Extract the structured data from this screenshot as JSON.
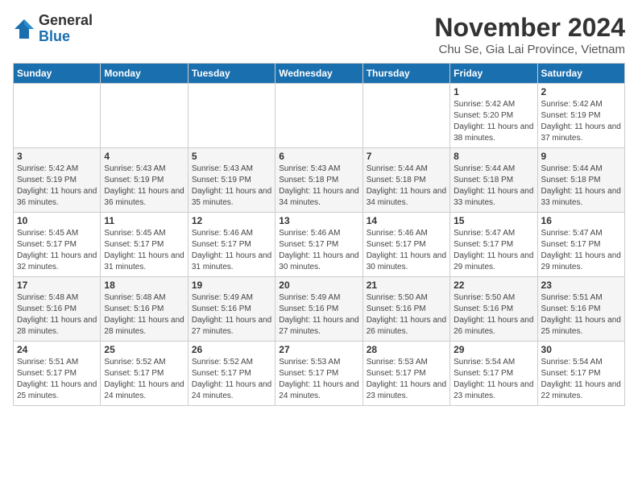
{
  "header": {
    "logo_general": "General",
    "logo_blue": "Blue",
    "month_title": "November 2024",
    "subtitle": "Chu Se, Gia Lai Province, Vietnam"
  },
  "weekdays": [
    "Sunday",
    "Monday",
    "Tuesday",
    "Wednesday",
    "Thursday",
    "Friday",
    "Saturday"
  ],
  "weeks": [
    [
      {
        "day": "",
        "info": ""
      },
      {
        "day": "",
        "info": ""
      },
      {
        "day": "",
        "info": ""
      },
      {
        "day": "",
        "info": ""
      },
      {
        "day": "",
        "info": ""
      },
      {
        "day": "1",
        "info": "Sunrise: 5:42 AM\nSunset: 5:20 PM\nDaylight: 11 hours\nand 38 minutes."
      },
      {
        "day": "2",
        "info": "Sunrise: 5:42 AM\nSunset: 5:19 PM\nDaylight: 11 hours\nand 37 minutes."
      }
    ],
    [
      {
        "day": "3",
        "info": "Sunrise: 5:42 AM\nSunset: 5:19 PM\nDaylight: 11 hours\nand 36 minutes."
      },
      {
        "day": "4",
        "info": "Sunrise: 5:43 AM\nSunset: 5:19 PM\nDaylight: 11 hours\nand 36 minutes."
      },
      {
        "day": "5",
        "info": "Sunrise: 5:43 AM\nSunset: 5:19 PM\nDaylight: 11 hours\nand 35 minutes."
      },
      {
        "day": "6",
        "info": "Sunrise: 5:43 AM\nSunset: 5:18 PM\nDaylight: 11 hours\nand 34 minutes."
      },
      {
        "day": "7",
        "info": "Sunrise: 5:44 AM\nSunset: 5:18 PM\nDaylight: 11 hours\nand 34 minutes."
      },
      {
        "day": "8",
        "info": "Sunrise: 5:44 AM\nSunset: 5:18 PM\nDaylight: 11 hours\nand 33 minutes."
      },
      {
        "day": "9",
        "info": "Sunrise: 5:44 AM\nSunset: 5:18 PM\nDaylight: 11 hours\nand 33 minutes."
      }
    ],
    [
      {
        "day": "10",
        "info": "Sunrise: 5:45 AM\nSunset: 5:17 PM\nDaylight: 11 hours\nand 32 minutes."
      },
      {
        "day": "11",
        "info": "Sunrise: 5:45 AM\nSunset: 5:17 PM\nDaylight: 11 hours\nand 31 minutes."
      },
      {
        "day": "12",
        "info": "Sunrise: 5:46 AM\nSunset: 5:17 PM\nDaylight: 11 hours\nand 31 minutes."
      },
      {
        "day": "13",
        "info": "Sunrise: 5:46 AM\nSunset: 5:17 PM\nDaylight: 11 hours\nand 30 minutes."
      },
      {
        "day": "14",
        "info": "Sunrise: 5:46 AM\nSunset: 5:17 PM\nDaylight: 11 hours\nand 30 minutes."
      },
      {
        "day": "15",
        "info": "Sunrise: 5:47 AM\nSunset: 5:17 PM\nDaylight: 11 hours\nand 29 minutes."
      },
      {
        "day": "16",
        "info": "Sunrise: 5:47 AM\nSunset: 5:17 PM\nDaylight: 11 hours\nand 29 minutes."
      }
    ],
    [
      {
        "day": "17",
        "info": "Sunrise: 5:48 AM\nSunset: 5:16 PM\nDaylight: 11 hours\nand 28 minutes."
      },
      {
        "day": "18",
        "info": "Sunrise: 5:48 AM\nSunset: 5:16 PM\nDaylight: 11 hours\nand 28 minutes."
      },
      {
        "day": "19",
        "info": "Sunrise: 5:49 AM\nSunset: 5:16 PM\nDaylight: 11 hours\nand 27 minutes."
      },
      {
        "day": "20",
        "info": "Sunrise: 5:49 AM\nSunset: 5:16 PM\nDaylight: 11 hours\nand 27 minutes."
      },
      {
        "day": "21",
        "info": "Sunrise: 5:50 AM\nSunset: 5:16 PM\nDaylight: 11 hours\nand 26 minutes."
      },
      {
        "day": "22",
        "info": "Sunrise: 5:50 AM\nSunset: 5:16 PM\nDaylight: 11 hours\nand 26 minutes."
      },
      {
        "day": "23",
        "info": "Sunrise: 5:51 AM\nSunset: 5:16 PM\nDaylight: 11 hours\nand 25 minutes."
      }
    ],
    [
      {
        "day": "24",
        "info": "Sunrise: 5:51 AM\nSunset: 5:17 PM\nDaylight: 11 hours\nand 25 minutes."
      },
      {
        "day": "25",
        "info": "Sunrise: 5:52 AM\nSunset: 5:17 PM\nDaylight: 11 hours\nand 24 minutes."
      },
      {
        "day": "26",
        "info": "Sunrise: 5:52 AM\nSunset: 5:17 PM\nDaylight: 11 hours\nand 24 minutes."
      },
      {
        "day": "27",
        "info": "Sunrise: 5:53 AM\nSunset: 5:17 PM\nDaylight: 11 hours\nand 24 minutes."
      },
      {
        "day": "28",
        "info": "Sunrise: 5:53 AM\nSunset: 5:17 PM\nDaylight: 11 hours\nand 23 minutes."
      },
      {
        "day": "29",
        "info": "Sunrise: 5:54 AM\nSunset: 5:17 PM\nDaylight: 11 hours\nand 23 minutes."
      },
      {
        "day": "30",
        "info": "Sunrise: 5:54 AM\nSunset: 5:17 PM\nDaylight: 11 hours\nand 22 minutes."
      }
    ]
  ]
}
